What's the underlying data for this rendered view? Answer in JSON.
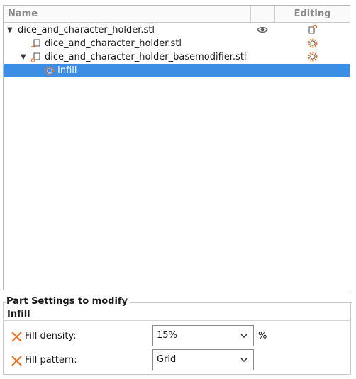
{
  "tree": {
    "columns": {
      "name": "Name",
      "visibility": "",
      "editing": "Editing"
    },
    "rows": [
      {
        "label": "dice_and_character_holder.stl",
        "level": 0,
        "expanded": true,
        "icon": "object-icon",
        "visible_icon": "eye-icon",
        "editing_icon": "object-edit-icon"
      },
      {
        "label": "dice_and_character_holder.stl",
        "level": 1,
        "icon": "part-icon",
        "editing_icon": "settings-gear-icon"
      },
      {
        "label": "dice_and_character_holder_basemodifier.stl",
        "level": 1,
        "expanded": true,
        "icon": "modifier-icon",
        "editing_icon": "settings-gear-icon"
      },
      {
        "label": "Infill",
        "level": 2,
        "selected": true,
        "icon": "settings-gear-icon"
      }
    ]
  },
  "settings": {
    "title": "Part Settings to modify",
    "group_title": "Infill",
    "fields": [
      {
        "label": "Fill density:",
        "value": "15%",
        "unit": "%"
      },
      {
        "label": "Fill pattern:",
        "value": "Grid",
        "unit": ""
      }
    ]
  },
  "colors": {
    "selection": "#3a8ee6",
    "accent": "#e8732a"
  }
}
